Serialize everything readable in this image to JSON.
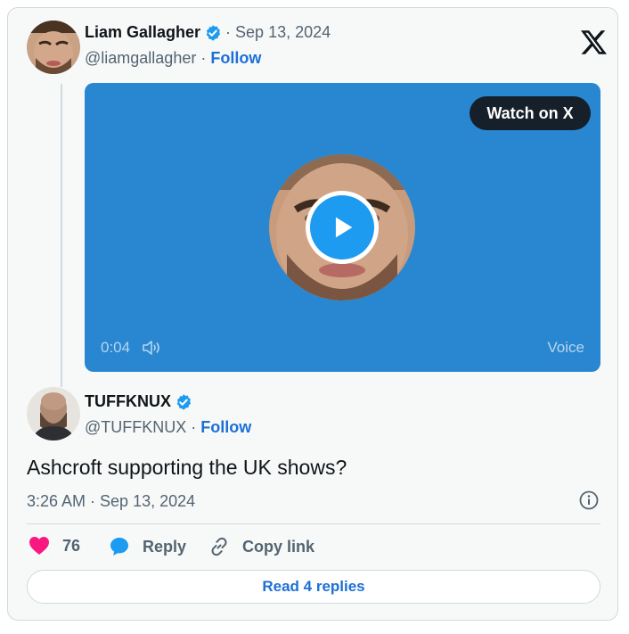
{
  "parent_tweet": {
    "name": "Liam Gallagher",
    "date": "· Sep 13, 2024",
    "handle": "@liamgallagher",
    "separator": " · ",
    "follow": "Follow"
  },
  "video": {
    "watch_label": "Watch on X",
    "duration": "0:04",
    "voice_label": "Voice"
  },
  "reply_tweet": {
    "name": "TUFFKNUX",
    "handle": "@TUFFKNUX",
    "separator": " · ",
    "follow": "Follow",
    "text": "Ashcroft supporting the UK shows?",
    "timestamp": "3:26 AM · Sep 13, 2024"
  },
  "actions": {
    "like_count": "76",
    "reply_label": "Reply",
    "copy_label": "Copy link"
  },
  "footer": {
    "read_replies": "Read 4 replies"
  },
  "colors": {
    "verified": "#1d9bf0",
    "like": "#f91880",
    "link": "#1d6fd6",
    "video_bg": "#2887d0"
  }
}
